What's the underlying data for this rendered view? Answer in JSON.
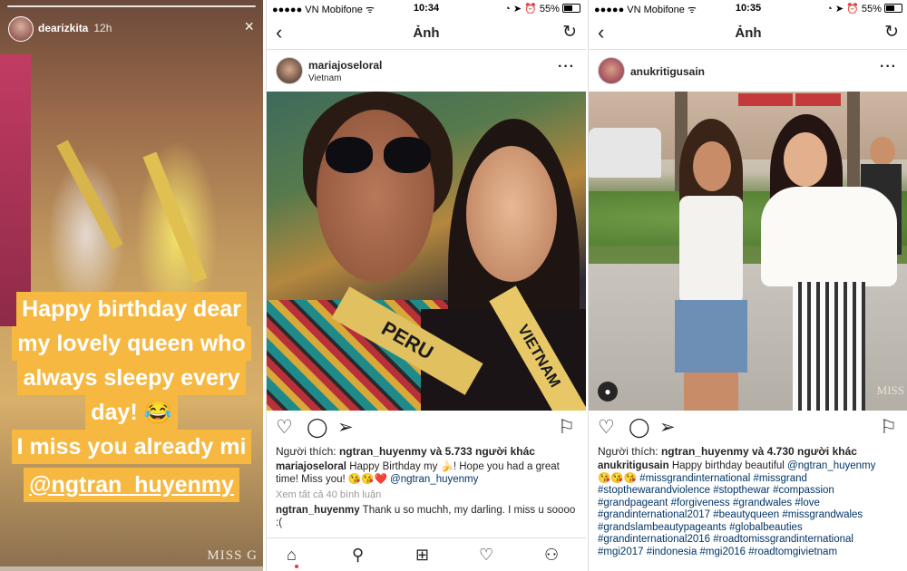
{
  "story": {
    "username": "dearizkita",
    "time": "12h",
    "close_icon": "×",
    "caption_lines": [
      "Happy birthday dear",
      "my lovely queen who",
      "always sleepy every",
      "day! 😂",
      "I miss you already mi"
    ],
    "mention": "@ngtran_huyenmy",
    "watermark": "MISS G"
  },
  "post1": {
    "status": {
      "carrier": "VN Mobifone",
      "time": "10:34",
      "battery": "55%"
    },
    "nav_title": "Ảnh",
    "username": "mariajoseloral",
    "location": "Vietnam",
    "sash_left": "PERU",
    "sash_right": "VIETNAM",
    "likes_prefix": "Người thích:",
    "likes_user": "ngtran_huyenmy",
    "likes_suffix": "và 5.733 người khác",
    "caption_user": "mariajoseloral",
    "caption_text": "Happy Birthday my 🍌! Hope you had a great time! Miss you! 😘😘❤️",
    "caption_tag": "@ngtran_huyenmy",
    "view_all": "Xem tất cả 40 bình luận",
    "comment_user": "ngtran_huyenmy",
    "comment_text": "Thank u so muchh, my darling. I miss u soooo :("
  },
  "post2": {
    "status": {
      "carrier": "VN Mobifone",
      "time": "10:35",
      "battery": "55%"
    },
    "nav_title": "Ảnh",
    "username": "anukritigusain",
    "likes_prefix": "Người thích:",
    "likes_user": "ngtran_huyenmy",
    "likes_suffix": "và 4.730 người khác",
    "caption_user": "anukritigusain",
    "caption_text": "Happy birthday beautiful",
    "caption_tag": "@ngtran_huyenmy",
    "caption_emoji": "😘😘😘",
    "hashtags": [
      "#missgrandinternational #missgrand",
      "#stopthewarandviolence #stopthewar #compassion",
      "#grandpageant #forgiveness #grandwales #love",
      "#grandinternational2017 #beautyqueen #missgrandwales",
      "#grandslambeautypageants #globalbeauties",
      "#grandinternational2016 #roadtomissgrandinternational",
      "#mgi2017 #indonesia #mgi2016 #roadtomgivietnam"
    ],
    "watermark": "MISS"
  }
}
